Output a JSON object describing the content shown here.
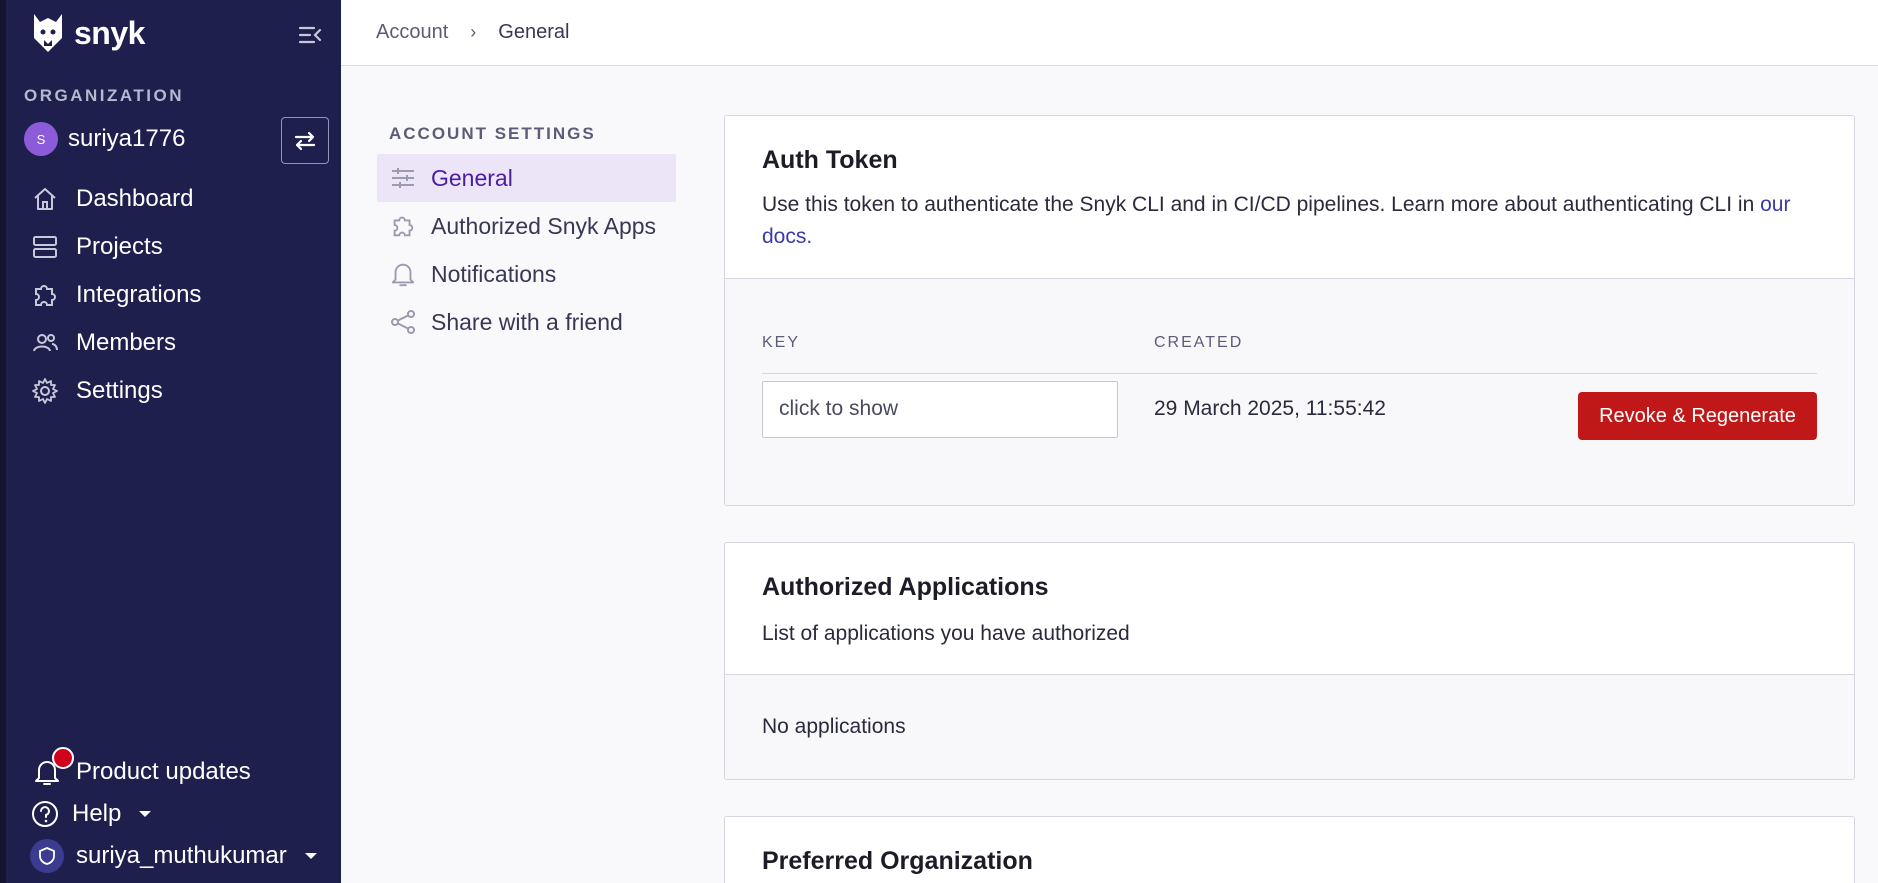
{
  "sidebar": {
    "brand": "snyk",
    "org_label": "ORGANIZATION",
    "org_avatar_letter": "S",
    "org_name": "suriya1776",
    "items": [
      {
        "label": "Dashboard",
        "icon": "home-icon"
      },
      {
        "label": "Projects",
        "icon": "projects-icon"
      },
      {
        "label": "Integrations",
        "icon": "puzzle-icon"
      },
      {
        "label": "Members",
        "icon": "members-icon"
      },
      {
        "label": "Settings",
        "icon": "gear-icon"
      }
    ],
    "product_updates": "Product updates",
    "help": "Help",
    "user": "suriya_muthukumar"
  },
  "breadcrumb": {
    "parent": "Account",
    "current": "General"
  },
  "settings_nav": {
    "title": "ACCOUNT SETTINGS",
    "items": [
      {
        "label": "General",
        "icon": "sliders-icon",
        "active": true
      },
      {
        "label": "Authorized Snyk Apps",
        "icon": "puzzle-icon"
      },
      {
        "label": "Notifications",
        "icon": "bell-icon"
      },
      {
        "label": "Share with a friend",
        "icon": "share-icon"
      }
    ]
  },
  "auth_token": {
    "title": "Auth Token",
    "description": "Use this token to authenticate the Snyk CLI and in CI/CD pipelines. Learn more about authenticating CLI in",
    "docs_link": "our docs.",
    "col_key": "KEY",
    "col_created": "CREATED",
    "key_value": "click to show",
    "created_value": "29 March 2025, 11:55:42",
    "revoke_label": "Revoke & Regenerate"
  },
  "authorized_apps": {
    "title": "Authorized Applications",
    "description": "List of applications you have authorized",
    "empty": "No applications"
  },
  "preferred_org": {
    "title": "Preferred Organization"
  },
  "colors": {
    "sidebar_bg": "#1f1f4d",
    "active_nav_bg": "#ece4f7",
    "danger": "#c01818",
    "link": "#3a3aa8"
  }
}
